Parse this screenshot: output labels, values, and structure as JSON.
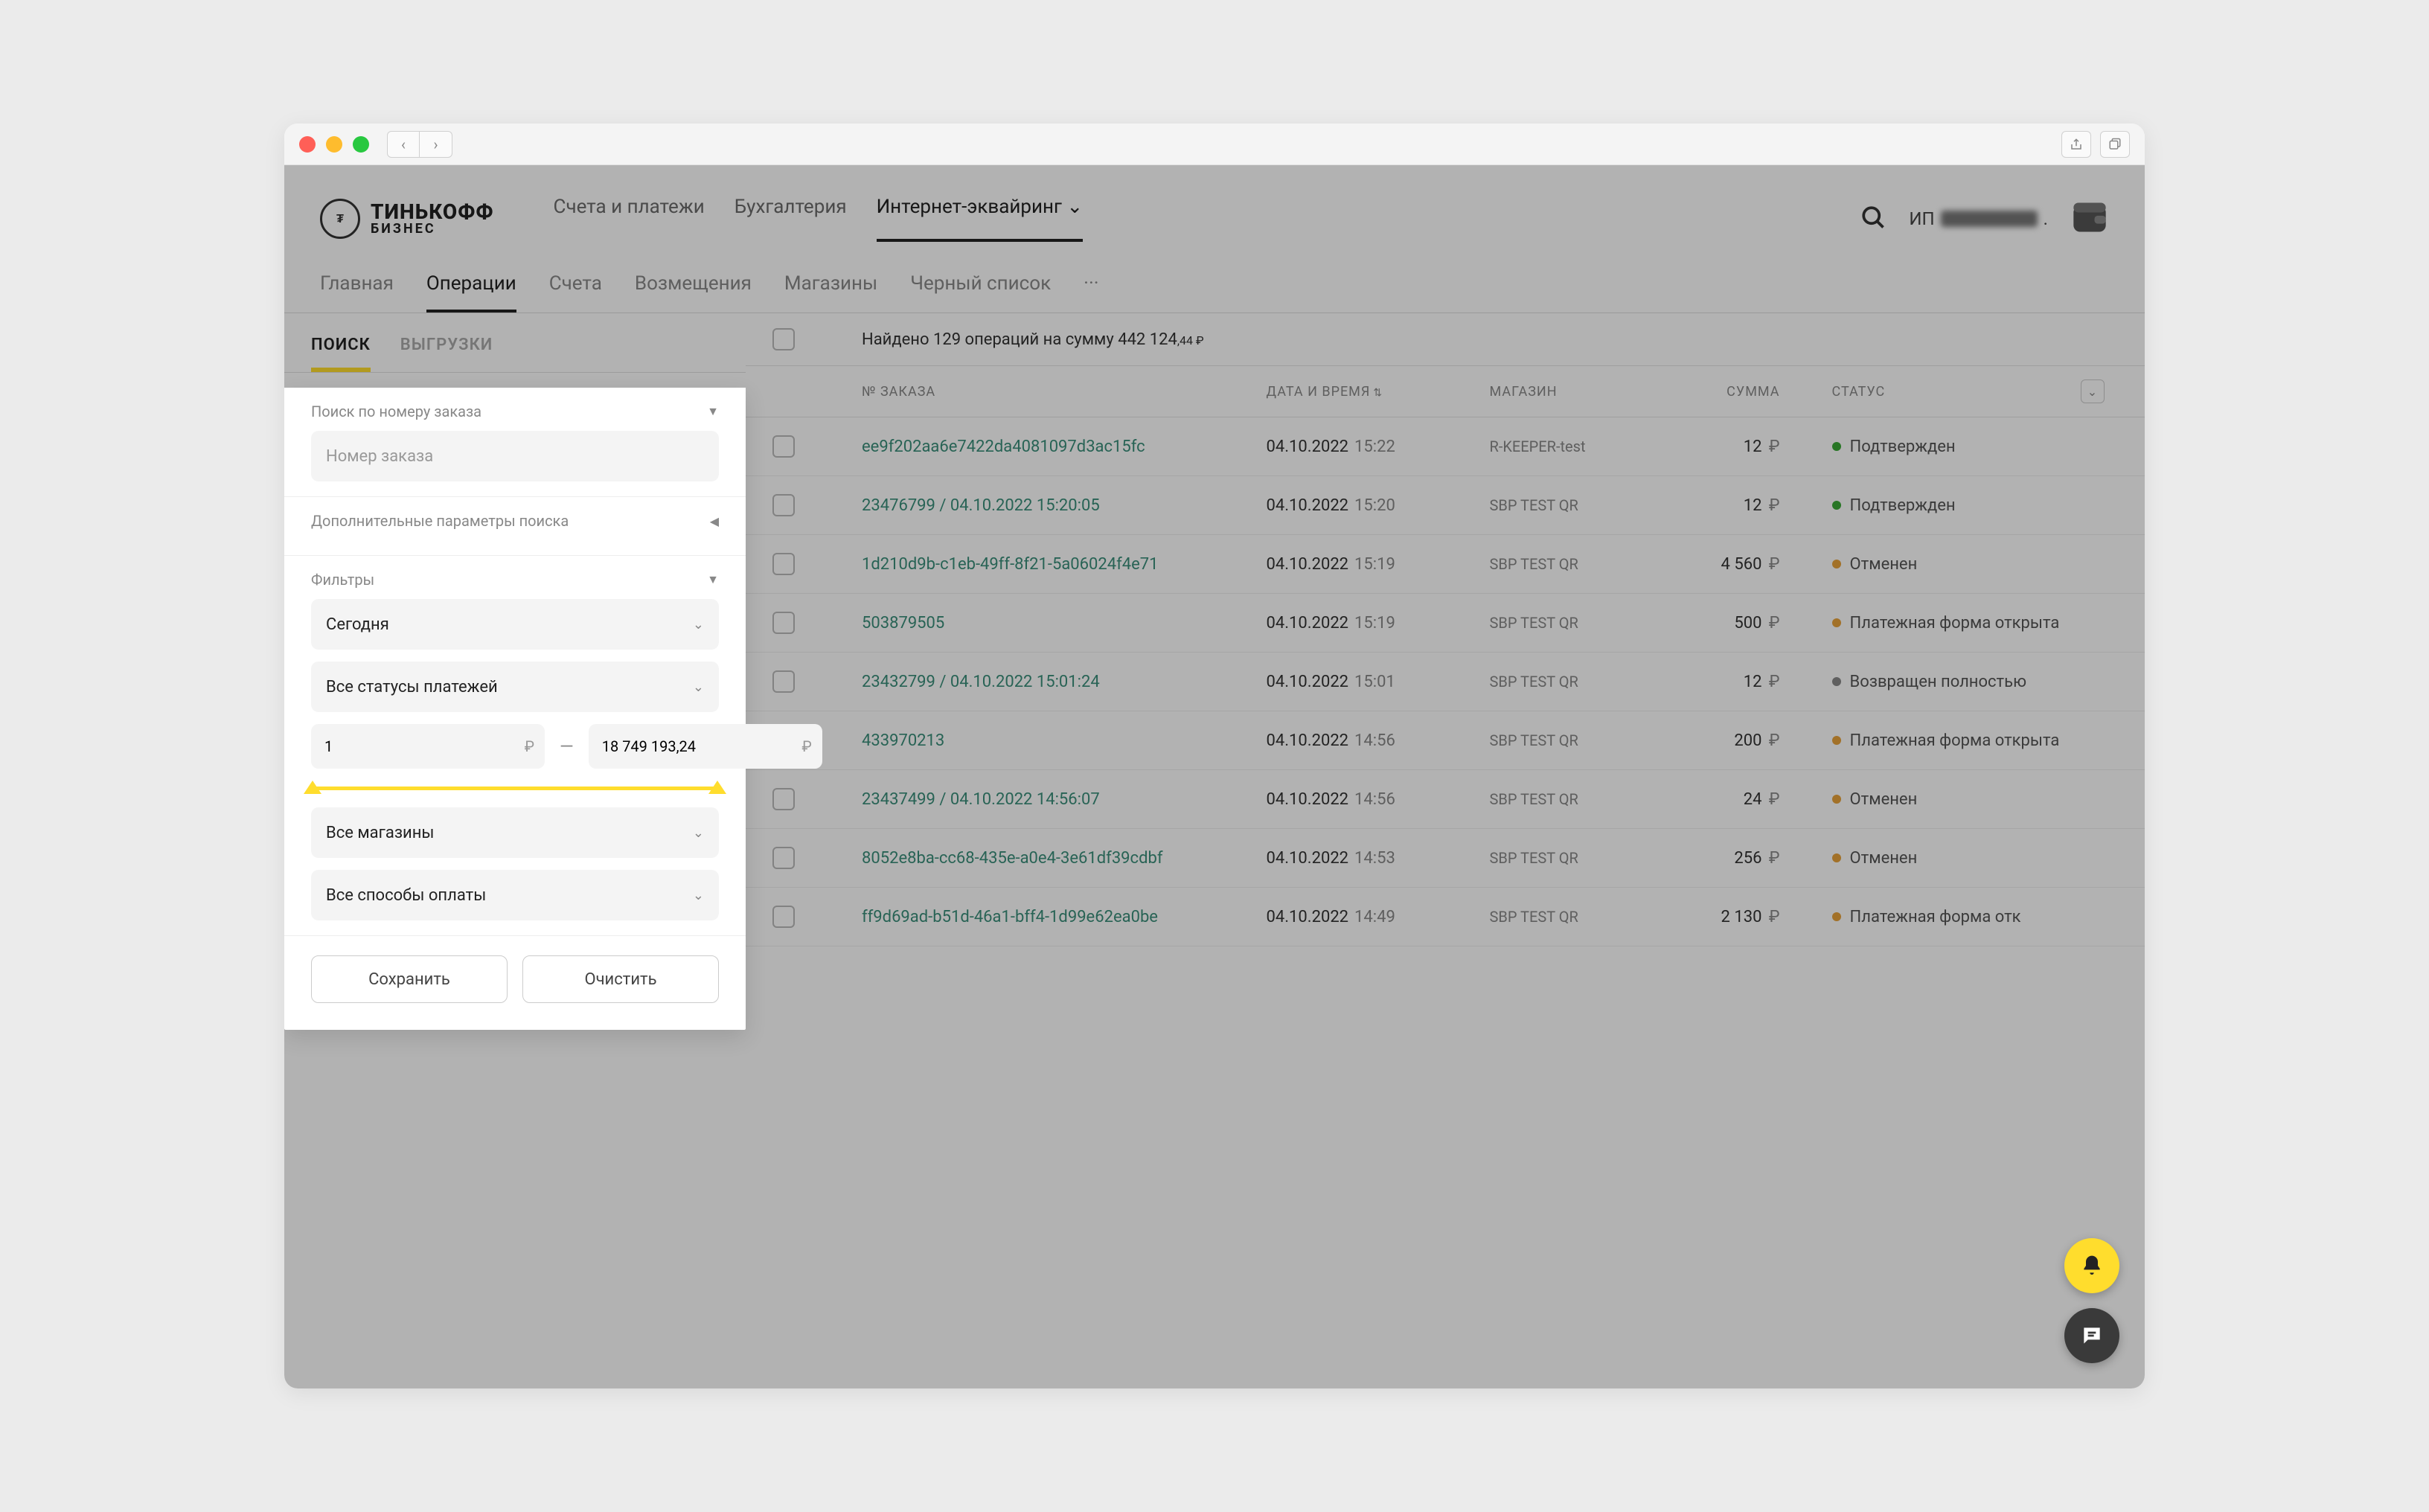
{
  "brand": {
    "line1": "ТИНЬКОФФ",
    "line2": "БИЗНЕС"
  },
  "top_nav": {
    "accounts": "Счета и платежи",
    "accounting": "Бухгалтерия",
    "acquiring": "Интернет-эквайринг"
  },
  "user": {
    "prefix": "ИП"
  },
  "sub_nav": {
    "main": "Главная",
    "operations": "Операции",
    "invoices": "Счета",
    "refunds": "Возмещения",
    "shops": "Магазины",
    "blacklist": "Черный список"
  },
  "sidebar_tabs": {
    "search": "ПОИСК",
    "export": "ВЫГРУЗКИ"
  },
  "search_panel": {
    "by_order_label": "Поиск по номеру заказа",
    "order_placeholder": "Номер заказа",
    "extra_params_label": "Дополнительные параметры поиска",
    "filters_label": "Фильтры",
    "period_value": "Сегодня",
    "status_value": "Все статусы платежей",
    "range_min": "1",
    "range_max": "18 749 193,24",
    "shops_value": "Все магазины",
    "pay_methods_value": "Все способы оплаты",
    "save_btn": "Сохранить",
    "clear_btn": "Очистить",
    "rub_symbol": "₽"
  },
  "results": {
    "summary_prefix": "Найдено 129 операций на сумму 442 124",
    "summary_cents": ",44 ₽"
  },
  "columns": {
    "order": "№ ЗАКАЗА",
    "date": "ДАТА И ВРЕМЯ",
    "shop": "МАГАЗИН",
    "sum": "СУММА",
    "status": "СТАТУС"
  },
  "statuses": {
    "confirmed": "Подтвержден",
    "cancelled": "Отменен",
    "form_open": "Платежная форма открыта",
    "refunded_full": "Возвращен полностью",
    "form_open_cut": "Платежная форма отк"
  },
  "rows": [
    {
      "order": "ee9f202aa6e7422da4081097d3ac15fc",
      "date": "04.10.2022",
      "time": "15:22",
      "shop": "R-KEEPER-test",
      "sum": "12",
      "status_key": "confirmed",
      "dot": "dot-green"
    },
    {
      "order": "23476799 / 04.10.2022 15:20:05",
      "date": "04.10.2022",
      "time": "15:20",
      "shop": "SBP TEST QR",
      "sum": "12",
      "status_key": "confirmed",
      "dot": "dot-green"
    },
    {
      "order": "1d210d9b-c1eb-49ff-8f21-5a06024f4e71",
      "date": "04.10.2022",
      "time": "15:19",
      "shop": "SBP TEST QR",
      "sum": "4 560",
      "status_key": "cancelled",
      "dot": "dot-orange"
    },
    {
      "order": "503879505",
      "date": "04.10.2022",
      "time": "15:19",
      "shop": "SBP TEST QR",
      "sum": "500",
      "status_key": "form_open",
      "dot": "dot-orange"
    },
    {
      "order": "23432799 / 04.10.2022 15:01:24",
      "date": "04.10.2022",
      "time": "15:01",
      "shop": "SBP TEST QR",
      "sum": "12",
      "status_key": "refunded_full",
      "dot": "dot-gray"
    },
    {
      "order": "433970213",
      "date": "04.10.2022",
      "time": "14:56",
      "shop": "SBP TEST QR",
      "sum": "200",
      "status_key": "form_open",
      "dot": "dot-orange"
    },
    {
      "order": "23437499 / 04.10.2022 14:56:07",
      "date": "04.10.2022",
      "time": "14:56",
      "shop": "SBP TEST QR",
      "sum": "24",
      "status_key": "cancelled",
      "dot": "dot-orange"
    },
    {
      "order": "8052e8ba-cc68-435e-a0e4-3e61df39cdbf",
      "date": "04.10.2022",
      "time": "14:53",
      "shop": "SBP TEST QR",
      "sum": "256",
      "status_key": "cancelled",
      "dot": "dot-orange"
    },
    {
      "order": "ff9d69ad-b51d-46a1-bff4-1d99e62ea0be",
      "date": "04.10.2022",
      "time": "14:49",
      "shop": "SBP TEST QR",
      "sum": "2 130",
      "status_key": "form_open_cut",
      "dot": "dot-orange"
    }
  ]
}
